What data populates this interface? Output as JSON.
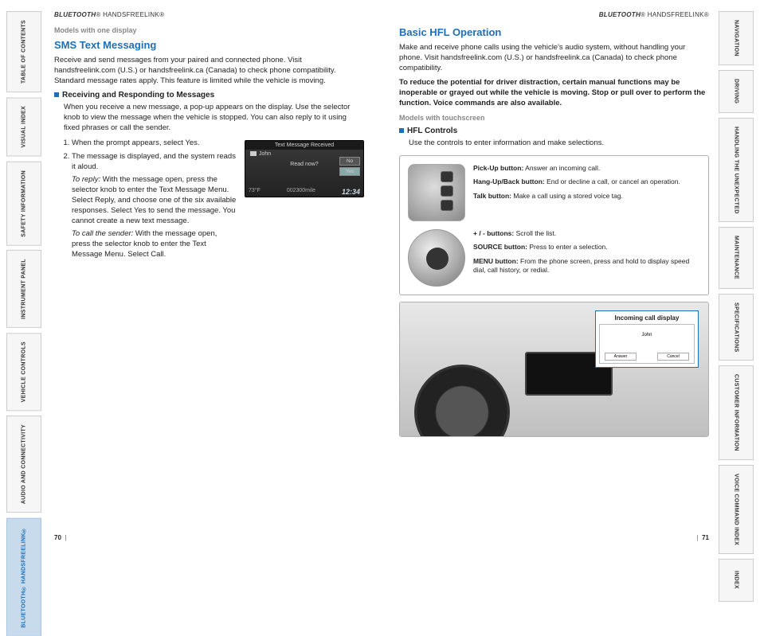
{
  "runhead": {
    "prefix": "BLUETOOTH",
    "suffix": "HANDSFREELINK",
    "reg": "®"
  },
  "left": {
    "models_note": "Models with one display",
    "title": "SMS Text Messaging",
    "intro": "Receive and send messages from your paired and connected phone. Visit handsfreelink.com (U.S.) or handsfreelink.ca (Canada) to check phone compatibility. Standard message rates apply. This feature is limited while the vehicle is moving.",
    "subhead": "Receiving and Responding to Messages",
    "sub_body": "When you receive a new message, a pop-up appears on the display. Use the selector knob to view the message when the vehicle is stopped. You can also reply to it using fixed phrases or call the sender.",
    "steps": [
      "When the prompt appears, select Yes.",
      "The message is displayed, and the system reads it aloud."
    ],
    "reply_label": "To reply:",
    "reply_text": " With the message open, press the selector knob to enter the Text Message Menu. Select Reply, and choose one of the six available responses. Select Yes to send the message. You cannot create a new text message.",
    "call_label": "To call the sender:",
    "call_text": " With the message open, press the selector knob to enter the Text Message Menu. Select Call.",
    "popup": {
      "title": "Text Message Received",
      "from": "John",
      "read": "Read now?",
      "no": "No",
      "yes": "Yes",
      "temp": "73°F",
      "odo": "002300mile",
      "time": "12:34"
    },
    "page": "70"
  },
  "right": {
    "title": "Basic HFL Operation",
    "intro": "Make and receive phone calls using the vehicle's audio system, without handling your phone. Visit handsfreelink.com (U.S.) or handsfreelink.ca (Canada) to check phone compatibility.",
    "warn": "To reduce the potential for driver distraction, certain manual functions may be inoperable or grayed out while the vehicle is moving. Stop or pull over to perform the function. Voice commands are also available.",
    "models_note": "Models with touchscreen",
    "subhead": "HFL Controls",
    "sub_body": "Use the controls to enter information and make selections.",
    "ctrl1": [
      {
        "b": "Pick-Up button:",
        "t": " Answer an incoming call."
      },
      {
        "b": "Hang-Up/Back button:",
        "t": " End or decline a call, or cancel an operation."
      },
      {
        "b": "Talk button:",
        "t": " Make a call using a stored voice tag."
      }
    ],
    "ctrl2": [
      {
        "b": "+ / - buttons:",
        "t": " Scroll the list."
      },
      {
        "b": "SOURCE button:",
        "t": " Press to enter a selection."
      },
      {
        "b": "MENU button:",
        "t": " From the phone screen, press and hold to display speed dial, call history, or redial."
      }
    ],
    "callout_title": "Incoming call display",
    "callout_caller": "John",
    "callout_answer": "Answer",
    "callout_cancel": "Cancel",
    "page": "71"
  },
  "tabs_left": [
    "TABLE OF CONTENTS",
    "VISUAL INDEX",
    "SAFETY INFORMATION",
    "INSTRUMENT PANEL",
    "VEHICLE CONTROLS",
    "AUDIO AND CONNECTIVITY",
    "BLUETOOTH® HANDSFREELINK®"
  ],
  "tabs_right": [
    "NAVIGATION",
    "DRIVING",
    "HANDLING THE UNEXPECTED",
    "MAINTENANCE",
    "SPECIFICATIONS",
    "CUSTOMER INFORMATION",
    "VOICE COMMAND INDEX",
    "INDEX"
  ],
  "active_tab": "BLUETOOTH® HANDSFREELINK®"
}
